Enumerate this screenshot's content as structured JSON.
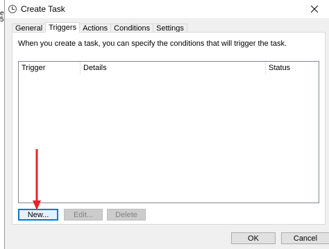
{
  "window": {
    "title": "Create Task",
    "close_glyph": "close-icon"
  },
  "tabs": [
    {
      "label": "General"
    },
    {
      "label": "Triggers",
      "active": true
    },
    {
      "label": "Actions"
    },
    {
      "label": "Conditions"
    },
    {
      "label": "Settings"
    }
  ],
  "triggers": {
    "intro": "When you create a task, you can specify the conditions that will trigger the task.",
    "columns": [
      "Trigger",
      "Details",
      "Status"
    ],
    "rows": [],
    "buttons": {
      "new": "New...",
      "edit": "Edit...",
      "delete": "Delete"
    }
  },
  "dialog_buttons": {
    "ok": "OK",
    "cancel": "Cancel"
  },
  "desktop_fragments": [
    "e",
    "5"
  ],
  "colors": {
    "arrow": "#e8222a",
    "focus_border": "#0078d7"
  }
}
